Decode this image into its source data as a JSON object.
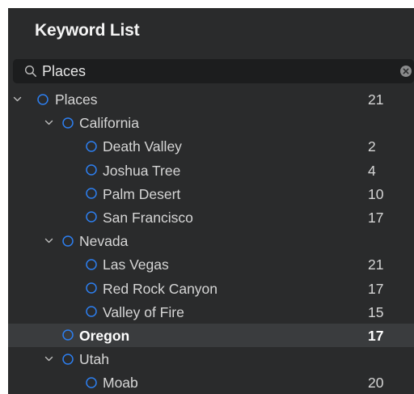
{
  "panel": {
    "title": "Keyword List"
  },
  "search": {
    "value": "Places",
    "search_icon": "magnifier-icon",
    "clear_icon": "clear-x-icon"
  },
  "colors": {
    "panel_bg": "#2a2b2c",
    "search_bg": "#1c1d1e",
    "selected_row_bg": "#3a3c3e",
    "circle_blue": "#2d7ff0",
    "text": "#d6d6d6"
  },
  "tree": [
    {
      "label": "Places",
      "count": "21",
      "level": 0,
      "expanded": true
    },
    {
      "label": "California",
      "count": "",
      "level": 1,
      "expanded": true
    },
    {
      "label": "Death Valley",
      "count": "2",
      "level": 2
    },
    {
      "label": "Joshua Tree",
      "count": "4",
      "level": 2
    },
    {
      "label": "Palm Desert",
      "count": "10",
      "level": 2
    },
    {
      "label": "San Francisco",
      "count": "17",
      "level": 2
    },
    {
      "label": "Nevada",
      "count": "",
      "level": 1,
      "expanded": true
    },
    {
      "label": "Las Vegas",
      "count": "21",
      "level": 2
    },
    {
      "label": "Red Rock Canyon",
      "count": "17",
      "level": 2
    },
    {
      "label": "Valley of Fire",
      "count": "15",
      "level": 2
    },
    {
      "label": "Oregon",
      "count": "17",
      "level": 1,
      "selected": true
    },
    {
      "label": "Utah",
      "count": "",
      "level": 1,
      "expanded": true
    },
    {
      "label": "Moab",
      "count": "20",
      "level": 2
    }
  ]
}
